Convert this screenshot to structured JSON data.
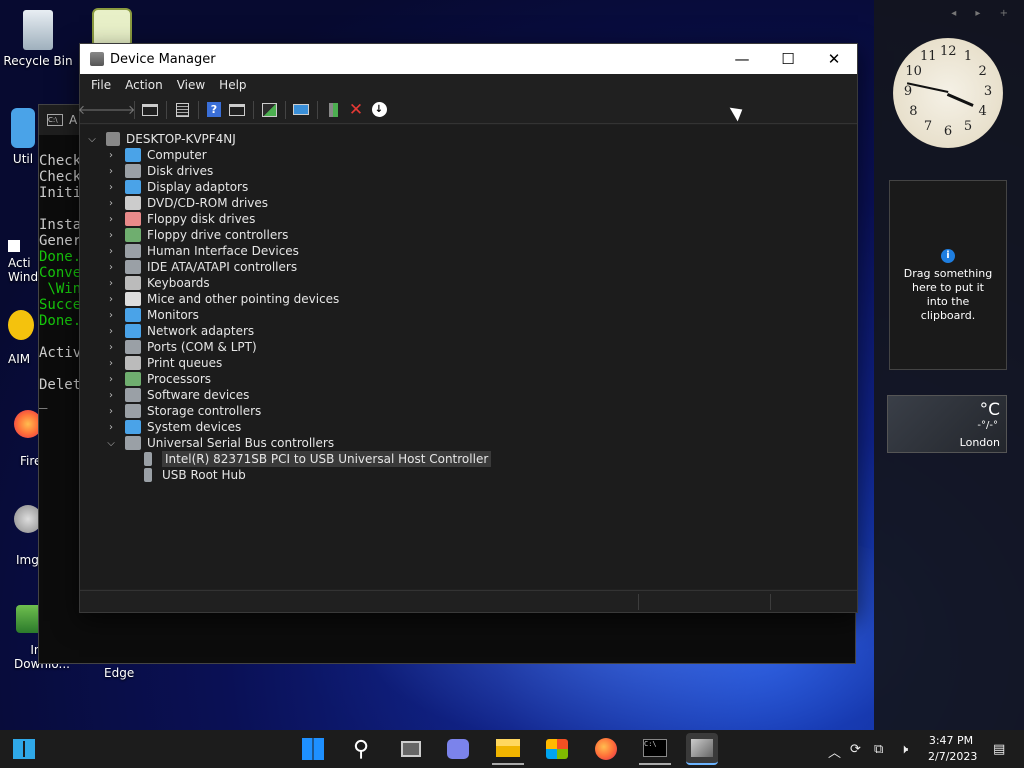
{
  "desktop": {
    "icons": [
      {
        "label": "Recycle Bin"
      },
      {
        "label": "Util"
      },
      {
        "label": "Acti\nWind"
      },
      {
        "label": "AIM"
      },
      {
        "label": "Fire"
      },
      {
        "label": "ImgI"
      },
      {
        "label": "Inte\nDownlo..."
      },
      {
        "label": "Edge"
      }
    ]
  },
  "console": {
    "title_char": "A",
    "lines": [
      {
        "text": "Check",
        "color": "gray"
      },
      {
        "text": "Check",
        "color": "gray"
      },
      {
        "text": "Initi",
        "color": "gray"
      },
      {
        "text": "",
        "color": "gray"
      },
      {
        "text": "Insta",
        "color": "gray"
      },
      {
        "text": "Gener",
        "color": "gray"
      },
      {
        "text": "Done.",
        "color": "green"
      },
      {
        "text": "Conve",
        "color": "green"
      },
      {
        "text": " \\Wind",
        "color": "green"
      },
      {
        "text": "Succe",
        "color": "green"
      },
      {
        "text": "Done.",
        "color": "green"
      },
      {
        "text": "",
        "color": "gray"
      },
      {
        "text": "Activ",
        "color": "gray"
      },
      {
        "text": "",
        "color": "gray"
      },
      {
        "text": "Delet",
        "color": "gray"
      },
      {
        "text": "_",
        "color": "gray"
      }
    ]
  },
  "window": {
    "title": "Device Manager",
    "minimize": "—",
    "maximize": "☐",
    "close": "✕"
  },
  "menu": [
    "File",
    "Action",
    "View",
    "Help"
  ],
  "toolbar": {
    "back": "🡐",
    "forward": "🡒",
    "icons": [
      "show-hide-console-tree-icon",
      "properties-icon",
      "help-icon",
      "console-icon",
      "scan-icon",
      "monitor-icon",
      "update-driver-icon",
      "uninstall-icon",
      "disable-icon"
    ]
  },
  "tree": {
    "root": "DESKTOP-KVPF4NJ",
    "categories": [
      {
        "label": "Computer",
        "color": "#4aa3e8"
      },
      {
        "label": "Disk drives",
        "color": "#9aa0a6"
      },
      {
        "label": "Display adaptors",
        "color": "#4aa3e8"
      },
      {
        "label": "DVD/CD-ROM drives",
        "color": "#cccccc"
      },
      {
        "label": "Floppy disk drives",
        "color": "#e88a8a"
      },
      {
        "label": "Floppy drive controllers",
        "color": "#6fae6f"
      },
      {
        "label": "Human Interface Devices",
        "color": "#9aa0a6"
      },
      {
        "label": "IDE ATA/ATAPI controllers",
        "color": "#9aa0a6"
      },
      {
        "label": "Keyboards",
        "color": "#bbbbbb"
      },
      {
        "label": "Mice and other pointing devices",
        "color": "#dddddd"
      },
      {
        "label": "Monitors",
        "color": "#4aa3e8"
      },
      {
        "label": "Network adapters",
        "color": "#4aa3e8"
      },
      {
        "label": "Ports (COM & LPT)",
        "color": "#9aa0a6"
      },
      {
        "label": "Print queues",
        "color": "#bbbbbb"
      },
      {
        "label": "Processors",
        "color": "#6fae6f"
      },
      {
        "label": "Software devices",
        "color": "#9aa0a6"
      },
      {
        "label": "Storage controllers",
        "color": "#9aa0a6"
      },
      {
        "label": "System devices",
        "color": "#4aa3e8"
      },
      {
        "label": "Universal Serial Bus controllers",
        "color": "#9aa0a6"
      }
    ],
    "usb_children": [
      {
        "label": "Intel(R) 82371SB PCI to USB Universal Host Controller",
        "selected": true
      },
      {
        "label": "USB Root Hub",
        "selected": false
      }
    ]
  },
  "sidebar": {
    "nav": "◂ ▸ +",
    "clock": {
      "hour": 3,
      "minute": 47,
      "numbers": [
        "12",
        "1",
        "2",
        "3",
        "4",
        "5",
        "6",
        "7",
        "8",
        "9",
        "10",
        "11"
      ]
    },
    "clipboard": {
      "info": "i",
      "text": "Drag something here to put it into the clipboard."
    },
    "weather": {
      "unit": "°C",
      "range": "-°/-°",
      "city": "London"
    }
  },
  "taskbar": {
    "apps": [
      "start-icon",
      "search-icon",
      "task-view-icon",
      "chat-icon",
      "file-explorer-icon",
      "store-icon",
      "firefox-icon",
      "terminal-icon",
      "device-manager-icon"
    ],
    "time": "3:47 PM",
    "date": "2/7/2023"
  }
}
